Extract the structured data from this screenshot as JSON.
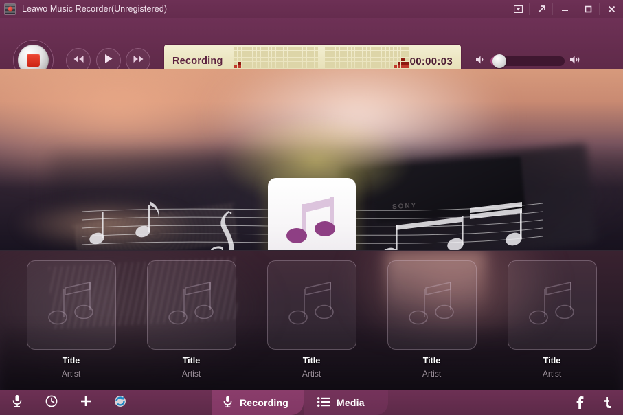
{
  "window": {
    "title": "Leawo Music Recorder(Unregistered)",
    "app_icon": "record-app-icon",
    "controls": [
      {
        "name": "skin-menu-button",
        "icon": "box-dropdown-icon"
      },
      {
        "name": "always-on-top-button",
        "icon": "arrow-up-right-icon"
      },
      {
        "name": "minimize-button",
        "icon": "minimize-icon"
      },
      {
        "name": "maximize-button",
        "icon": "maximize-icon"
      },
      {
        "name": "close-button",
        "icon": "close-icon"
      }
    ]
  },
  "transport": {
    "record_button": "record-stop-button",
    "record_state_icon": "stop-square-icon",
    "previous_label": "previous-icon",
    "play_label": "play-icon",
    "next_label": "next-icon"
  },
  "status": {
    "label": "Recording",
    "time": "00:00:03",
    "vu_left": [
      3,
      4,
      2,
      2,
      1,
      1,
      1,
      0,
      1,
      0,
      0,
      0,
      0,
      0,
      0,
      0,
      0,
      1,
      0,
      0,
      0,
      0
    ],
    "vu_right": [
      0,
      0,
      0,
      0,
      1,
      0,
      0,
      0,
      0,
      0,
      0,
      0,
      0,
      1,
      1,
      0,
      1,
      2,
      3,
      4,
      5,
      4
    ],
    "meter_on_color": "#c0392b",
    "meter_off_color": "#ddd5a8",
    "panel_color": "#ece6c2"
  },
  "volume": {
    "mute_icon": "speaker-low-icon",
    "max_icon": "speaker-high-icon",
    "level_percent": 12,
    "tick_percent": 82,
    "fill_color": "#a6447f"
  },
  "hero": {
    "album_art_icon": "music-note-icon",
    "background_label": "turntable-photo",
    "overlay_label": "music-staff-notes",
    "brand_text": "SONY"
  },
  "library": {
    "items": [
      {
        "title": "Title",
        "artist": "Artist"
      },
      {
        "title": "Title",
        "artist": "Artist"
      },
      {
        "title": "Title",
        "artist": "Artist"
      },
      {
        "title": "Title",
        "artist": "Artist"
      },
      {
        "title": "Title",
        "artist": "Artist"
      }
    ]
  },
  "bottombar": {
    "tools": [
      {
        "name": "audio-source-button",
        "icon": "microphone-icon"
      },
      {
        "name": "task-scheduler-button",
        "icon": "clock-icon"
      },
      {
        "name": "add-button",
        "icon": "plus-icon"
      },
      {
        "name": "refresh-button",
        "icon": "refresh-icon"
      }
    ],
    "tabs": [
      {
        "label": "Recording",
        "icon": "microphone-icon",
        "active": true
      },
      {
        "label": "Media",
        "icon": "list-icon",
        "active": false
      }
    ],
    "social": [
      {
        "name": "facebook-button",
        "glyph": "f"
      },
      {
        "name": "twitter-button",
        "glyph": "t"
      }
    ]
  },
  "theme": {
    "accent": "#8a3d6b",
    "chrome": "#652c4e",
    "record_red": "#cc2413"
  }
}
